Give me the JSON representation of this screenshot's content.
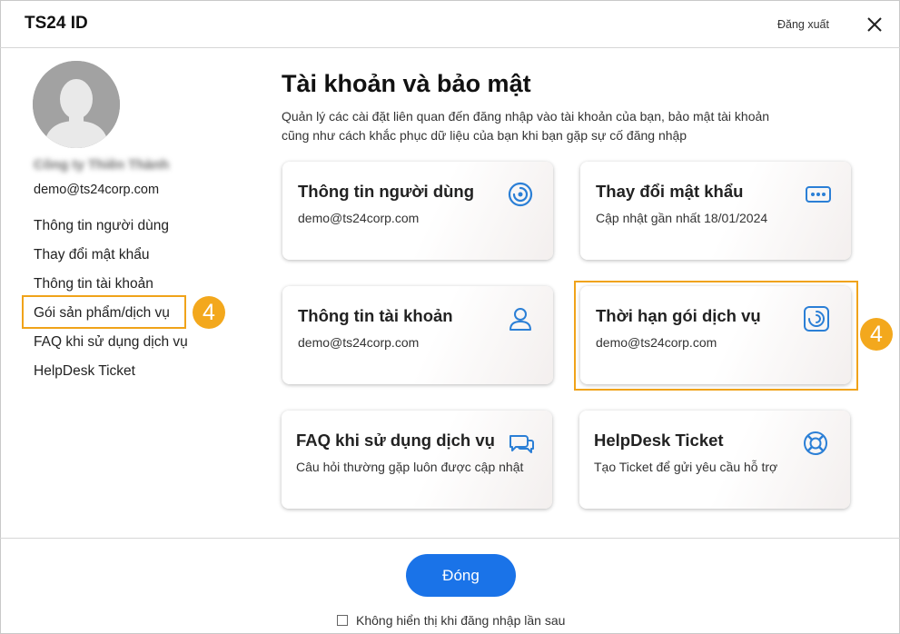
{
  "header": {
    "app_title": "TS24 ID",
    "logout_label": "Đăng xuất",
    "close_icon": "close-icon"
  },
  "sidebar": {
    "avatar_icon": "user-avatar-icon",
    "user_name": "Công ty Thiên Thành",
    "email": "demo@ts24corp.com",
    "items": [
      {
        "label": "Thông tin người dùng"
      },
      {
        "label": "Thay đổi mật khẩu"
      },
      {
        "label": "Thông tin tài khoản"
      },
      {
        "label": "Gói sản phẩm/dịch vụ"
      },
      {
        "label": "FAQ khi sử dụng dịch vụ"
      },
      {
        "label": "HelpDesk Ticket"
      }
    ],
    "badge": "4"
  },
  "main": {
    "title": "Tài khoản và bảo mật",
    "description": "Quản lý các cài đặt liên quan đến đăng nhập vào tài khoản của bạn, bảo mật tài khoản cũng như cách khắc phục dữ liệu của bạn khi bạn gặp sự cố đăng nhập",
    "cards": [
      {
        "title": "Thông tin người dùng",
        "subtitle": "demo@ts24corp.com",
        "icon": "swirl-icon"
      },
      {
        "title": "Thay đổi mật khẩu",
        "subtitle": "Cập nhật gần nhất 18/01/2024",
        "icon": "password-dots-icon"
      },
      {
        "title": "Thông tin tài khoản",
        "subtitle": "demo@ts24corp.com",
        "icon": "user-icon"
      },
      {
        "title": "Thời hạn gói dịch vụ",
        "subtitle": "demo@ts24corp.com",
        "icon": "swirl-box-icon"
      },
      {
        "title": "FAQ khi sử dụng dịch vụ",
        "subtitle": "Câu hỏi thường gặp luôn được cập nhật",
        "icon": "chat-bubbles-icon"
      },
      {
        "title": "HelpDesk Ticket",
        "subtitle": "Tạo Ticket để gửi yêu cầu hỗ trợ",
        "icon": "lifebuoy-icon"
      }
    ],
    "badge": "4"
  },
  "footer": {
    "close_label": "Đóng",
    "dont_show_label": "Không hiển thị khi đăng nhập lần sau",
    "dont_show_checked": false
  },
  "colors": {
    "accent": "#1a73e8",
    "highlight": "#f0a31a",
    "badge": "#f3a81d",
    "icon_blue": "#2b7fd6"
  }
}
